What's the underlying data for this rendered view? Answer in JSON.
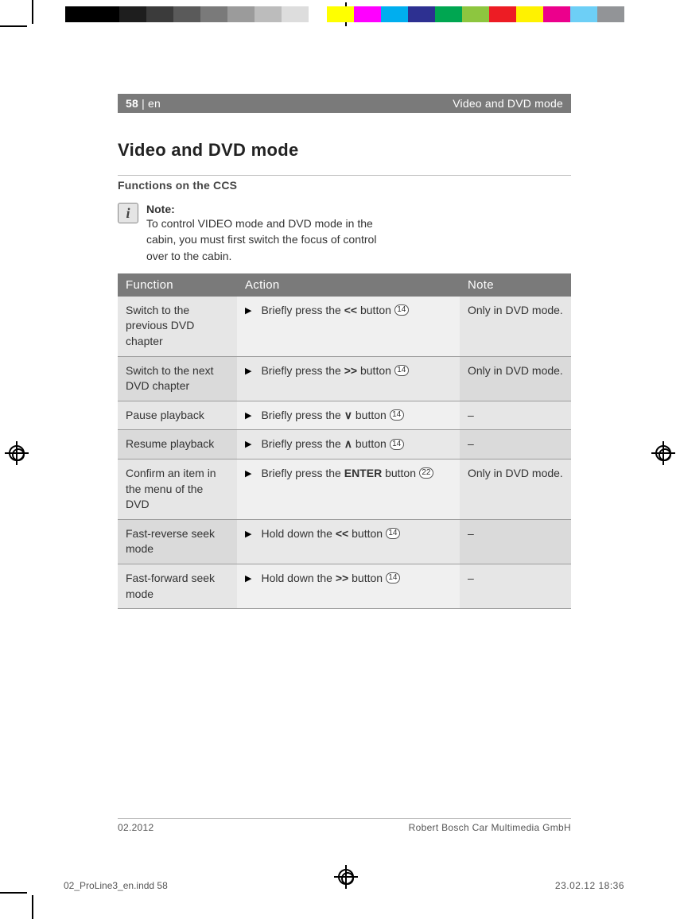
{
  "header": {
    "page_no": "58",
    "lang_sep": " | en",
    "section": "Video and DVD mode"
  },
  "title": "Video and DVD mode",
  "subtitle": "Functions on the CCS",
  "note": {
    "label": "Note:",
    "text": "To control VIDEO mode and DVD mode in the cabin, you must first switch the focus of control over to the cabin."
  },
  "table": {
    "headers": {
      "function": "Function",
      "action": "Action",
      "note": "Note"
    },
    "rows": [
      {
        "function": "Switch to the previous DVD chapter",
        "action_prefix": "Briefly press the ",
        "action_symbol": "<<",
        "action_mid": " button ",
        "action_ref": "14",
        "action_suffix": "",
        "note": "Only in DVD mode."
      },
      {
        "function": "Switch to the next DVD chapter",
        "action_prefix": "Briefly press the ",
        "action_symbol": ">>",
        "action_mid": " button ",
        "action_ref": "14",
        "action_suffix": "",
        "note": "Only in DVD mode."
      },
      {
        "function": "Pause playback",
        "action_prefix": "Briefly press the ",
        "action_symbol": "∨",
        "action_mid": " button ",
        "action_ref": "14",
        "action_suffix": "",
        "note": "–"
      },
      {
        "function": "Resume playback",
        "action_prefix": "Briefly press the ",
        "action_symbol": "∧",
        "action_mid": " button ",
        "action_ref": "14",
        "action_suffix": "",
        "note": "–"
      },
      {
        "function": "Confirm an item in the menu of the DVD",
        "action_prefix": "Briefly press the ",
        "action_symbol": "ENTER",
        "action_mid": " button ",
        "action_ref": "22",
        "action_suffix": "",
        "note": "Only in DVD mode."
      },
      {
        "function": "Fast-reverse seek mode",
        "action_prefix": "Hold down the ",
        "action_symbol": "<<",
        "action_mid": " button ",
        "action_ref": "14",
        "action_suffix": "",
        "note": "–"
      },
      {
        "function": "Fast-forward seek mode",
        "action_prefix": "Hold down the ",
        "action_symbol": ">>",
        "action_mid": " button ",
        "action_ref": "14",
        "action_suffix": "",
        "note": "–"
      }
    ]
  },
  "footer": {
    "date": "02.2012",
    "company": "Robert Bosch Car Multimedia GmbH"
  },
  "imprint": {
    "file": "02_ProLine3_en.indd   58",
    "stamp": "23.02.12   18:36"
  }
}
